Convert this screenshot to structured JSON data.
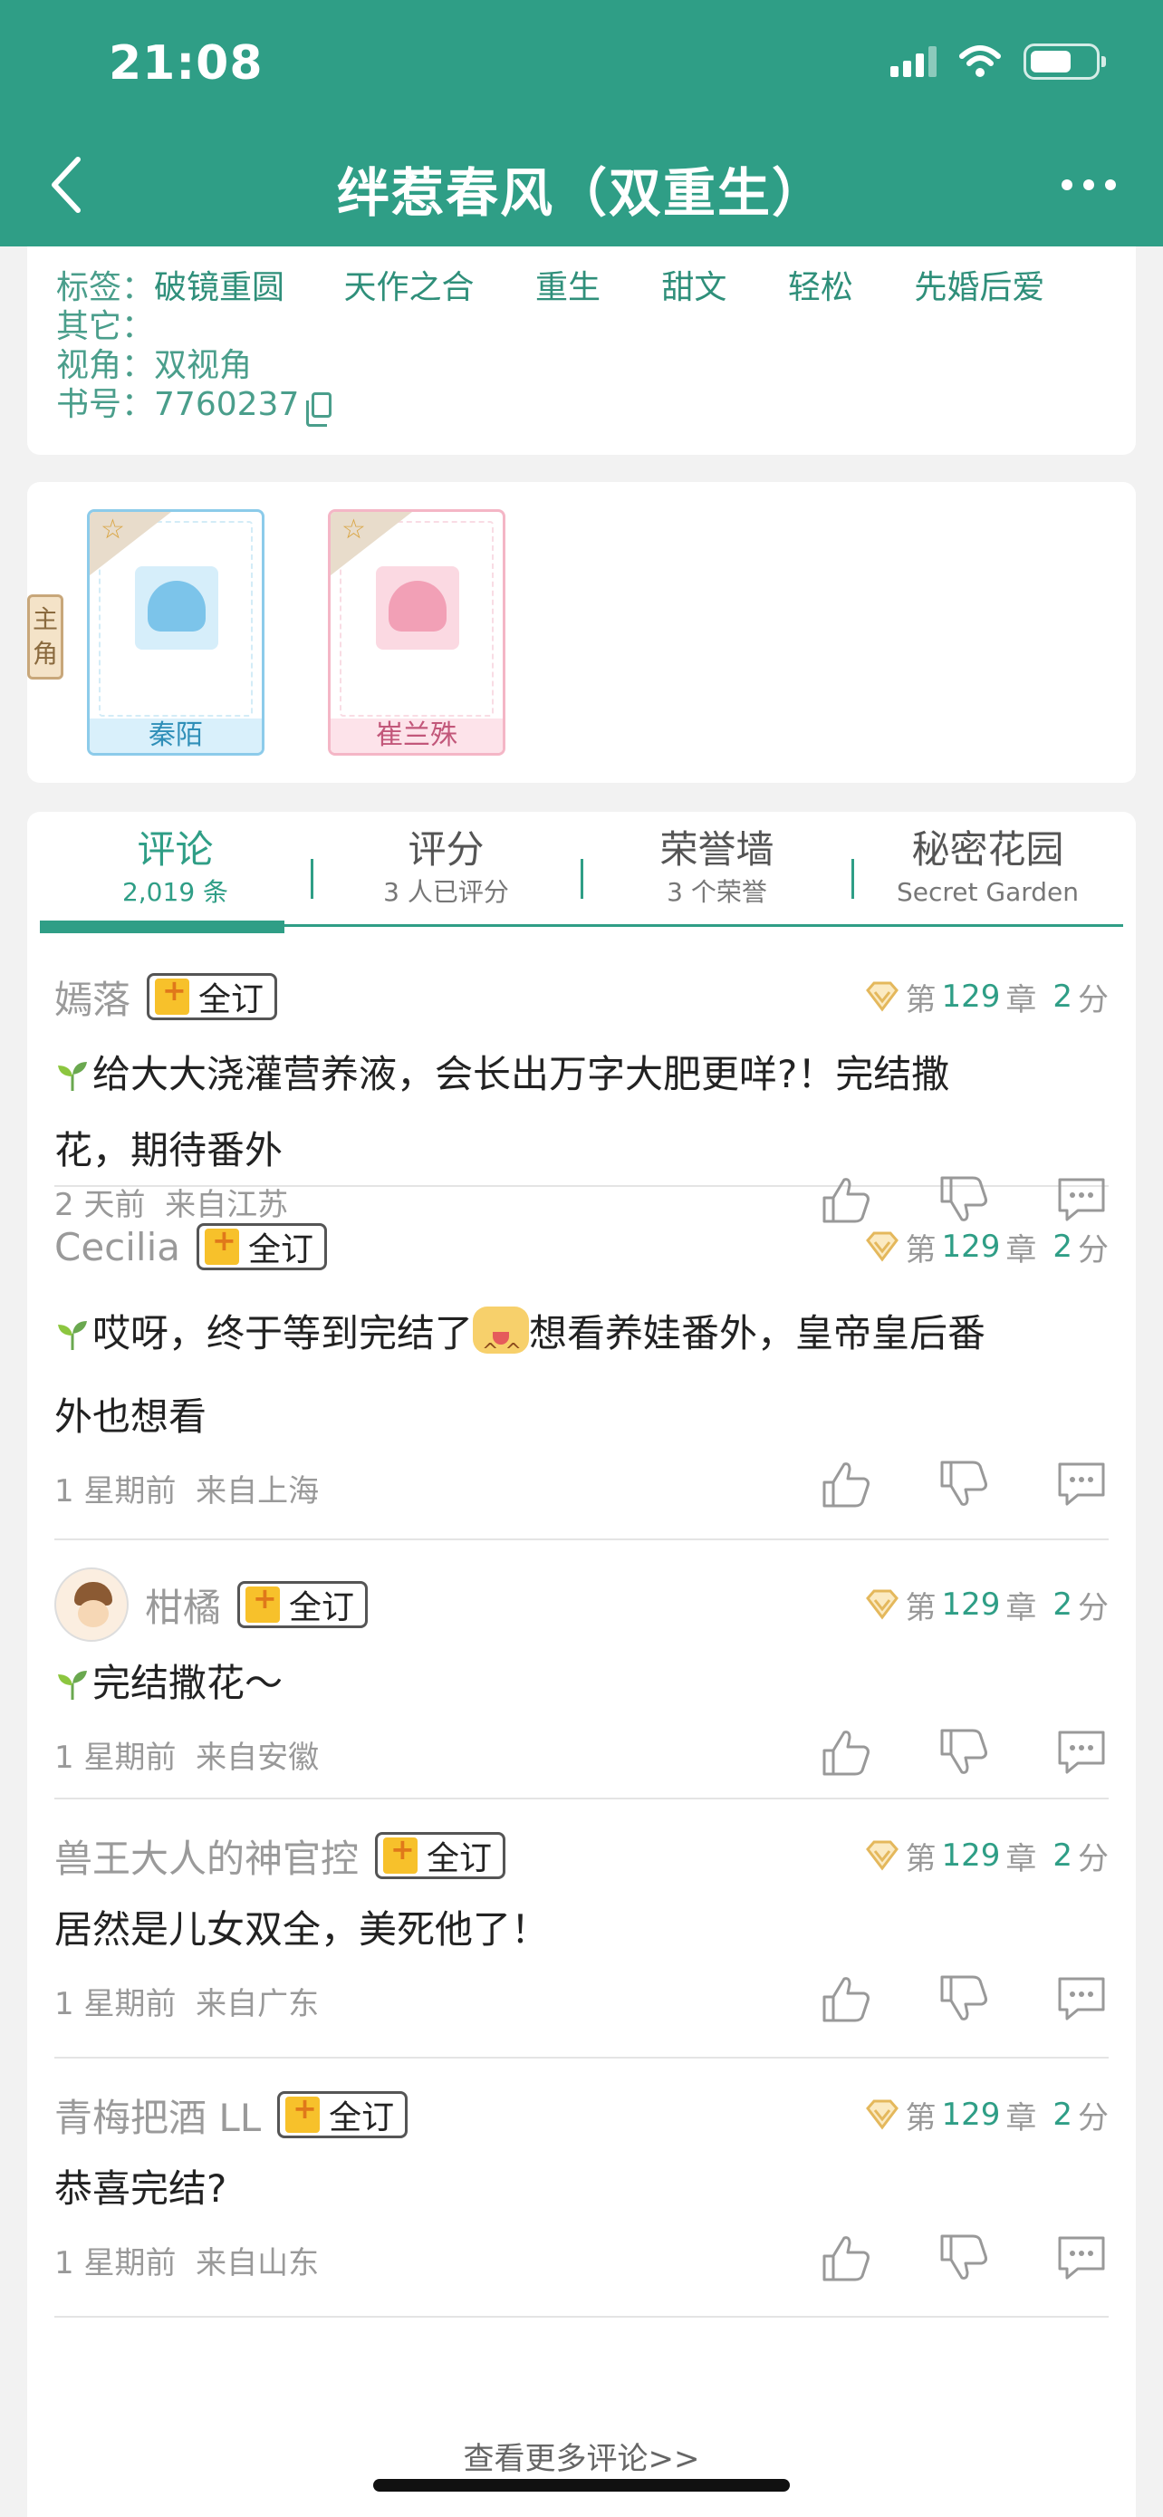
{
  "status_bar": {
    "time": "21:08"
  },
  "nav": {
    "title": "绊惹春风（双重生）"
  },
  "info": {
    "tags_label": "标签：",
    "tags": [
      "破镜重圆",
      "天作之合",
      "重生",
      "甜文",
      "轻松",
      "先婚后爱"
    ],
    "other_label": "其它：",
    "view_label": "视角：",
    "view_value": "双视角",
    "book_label": "书号：",
    "book_value": "7760237"
  },
  "roles": {
    "label_line1": "主",
    "label_line2": "角",
    "male_name": "秦陌",
    "female_name": "崔兰殊"
  },
  "tabs": [
    {
      "title": "评论",
      "sub": "2,019 条",
      "active": true
    },
    {
      "title": "评分",
      "sub": "3 人已评分",
      "active": false
    },
    {
      "title": "荣誉墙",
      "sub": "3 个荣誉",
      "active": false
    },
    {
      "title": "秘密花园",
      "sub": "Secret Garden",
      "active": false
    }
  ],
  "comments": [
    {
      "user": "嫣落",
      "badge": "全订",
      "chapter_prefix": "第",
      "chapter": "129",
      "chapter_suffix": "章",
      "score": "2",
      "score_unit": "分",
      "text_line1": "给大大浇灌营养液，会长出万字大肥更咩?！完结撒",
      "text_line2": "花，期待番外",
      "time": "2 天前",
      "location": "来自江苏"
    },
    {
      "user": "Cecilia",
      "badge": "全订",
      "chapter_prefix": "第",
      "chapter": "129",
      "chapter_suffix": "章",
      "score": "2",
      "score_unit": "分",
      "text_line1a": "哎呀，终于等到完结了",
      "text_line1b": "想看养娃番外，皇帝皇后番",
      "text_line2": "外也想看",
      "time": "1 星期前",
      "location": "来自上海"
    },
    {
      "user": "柑橘",
      "badge": "全订",
      "chapter_prefix": "第",
      "chapter": "129",
      "chapter_suffix": "章",
      "score": "2",
      "score_unit": "分",
      "text_line1": "完结撒花～",
      "time": "1 星期前",
      "location": "来自安徽"
    },
    {
      "user": "兽王大人的神官控",
      "badge": "全订",
      "chapter_prefix": "第",
      "chapter": "129",
      "chapter_suffix": "章",
      "score": "2",
      "score_unit": "分",
      "text_line1": "居然是儿女双全，美死他了！",
      "time": "1 星期前",
      "location": "来自广东"
    },
    {
      "user": "青梅把酒 LL",
      "badge": "全订",
      "chapter_prefix": "第",
      "chapter": "129",
      "chapter_suffix": "章",
      "score": "2",
      "score_unit": "分",
      "text_line1": "恭喜完结?",
      "time": "1 星期前",
      "location": "来自山东"
    }
  ],
  "more_link": "查看更多评论>>",
  "colors": {
    "brand": "#2f9e86",
    "accent_gold": "#f7c12b"
  },
  "icons": [
    "back-icon",
    "more-icon",
    "signal-icon",
    "wifi-icon",
    "battery-icon",
    "copy-icon",
    "star-icon",
    "vip-diamond-icon",
    "thumb-up-icon",
    "thumb-down-icon",
    "reply-icon",
    "sprout-icon"
  ]
}
